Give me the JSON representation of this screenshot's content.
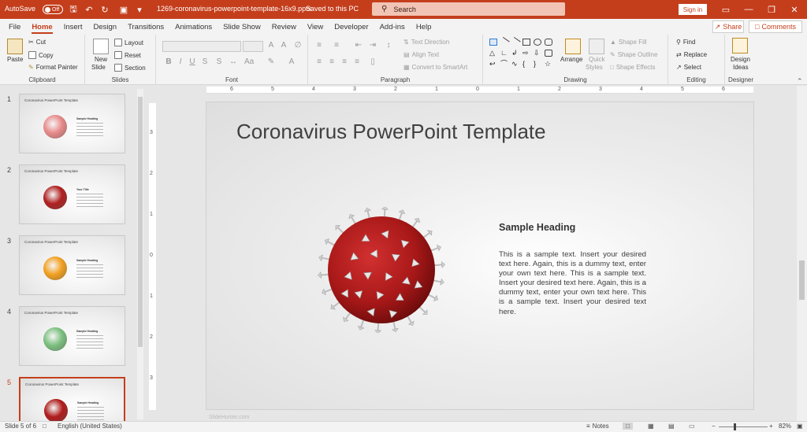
{
  "titlebar": {
    "autosave_label": "AutoSave",
    "autosave_state": "Off",
    "filename": "1269-coronavirus-powerpoint-template-16x9.pptx",
    "save_status": "Saved to this PC",
    "search_placeholder": "Search",
    "signin_label": "Sign in"
  },
  "tabs": [
    "File",
    "Home",
    "Insert",
    "Design",
    "Transitions",
    "Animations",
    "Slide Show",
    "Review",
    "View",
    "Developer",
    "Add-ins",
    "Help"
  ],
  "share_label": "Share",
  "comments_label": "Comments",
  "ribbon": {
    "clipboard": {
      "paste": "Paste",
      "cut": "Cut",
      "copy": "Copy",
      "format_painter": "Format Painter",
      "label": "Clipboard"
    },
    "slides": {
      "new_slide": "New",
      "new_slide2": "Slide",
      "layout": "Layout",
      "reset": "Reset",
      "section": "Section",
      "label": "Slides"
    },
    "font": {
      "bold": "B",
      "italic": "I",
      "underline": "U",
      "strike": "S",
      "label": "Font"
    },
    "paragraph": {
      "text_direction": "Text Direction",
      "align_text": "Align Text",
      "smartart": "Convert to SmartArt",
      "label": "Paragraph"
    },
    "drawing": {
      "arrange": "Arrange",
      "quick_styles": "Quick",
      "quick_styles2": "Styles",
      "shape_fill": "Shape Fill",
      "shape_outline": "Shape Outline",
      "shape_effects": "Shape Effects",
      "label": "Drawing"
    },
    "editing": {
      "find": "Find",
      "replace": "Replace",
      "select": "Select",
      "label": "Editing"
    },
    "designer": {
      "ideas": "Design",
      "ideas2": "Ideas",
      "label": "Designer"
    }
  },
  "thumbnails": [
    {
      "num": "1",
      "title": "Coronavirus PowerPoint Template",
      "color": "#e88a8a",
      "heading": "Sample Heading"
    },
    {
      "num": "2",
      "title": "Coronavirus PowerPoint Template",
      "color": "#b02020",
      "heading": "Your Title"
    },
    {
      "num": "3",
      "title": "Coronavirus PowerPoint Template",
      "color": "#f2a020",
      "heading": "Sample Heading"
    },
    {
      "num": "4",
      "title": "Coronavirus PowerPoint Template",
      "color": "#7cc080",
      "heading": "Sample Heading"
    },
    {
      "num": "5",
      "title": "Coronavirus PowerPoint Template",
      "color": "#b01c1c",
      "heading": "Sample Heading"
    }
  ],
  "ruler_numbers": [
    "6",
    "5",
    "4",
    "3",
    "2",
    "1",
    "0",
    "1",
    "2",
    "3",
    "4",
    "5",
    "6"
  ],
  "vruler_numbers": [
    "3",
    "2",
    "1",
    "0",
    "1",
    "2",
    "3"
  ],
  "slide": {
    "title": "Coronavirus PowerPoint Template",
    "heading": "Sample Heading",
    "body": "This is a sample text. Insert your desired text here. Again, this is a dummy text, enter your own text here. This is a sample text. Insert your desired text here. Again, this is a dummy text, enter your own text here. This is a sample text. Insert your desired text here.",
    "watermark": "SlideHunter.com"
  },
  "status": {
    "slide_info": "Slide 5 of 6",
    "language": "English (United States)",
    "notes": "Notes",
    "zoom": "82%"
  },
  "colors": {
    "accent": "#c43e1c",
    "virus": "#b01c1c"
  }
}
